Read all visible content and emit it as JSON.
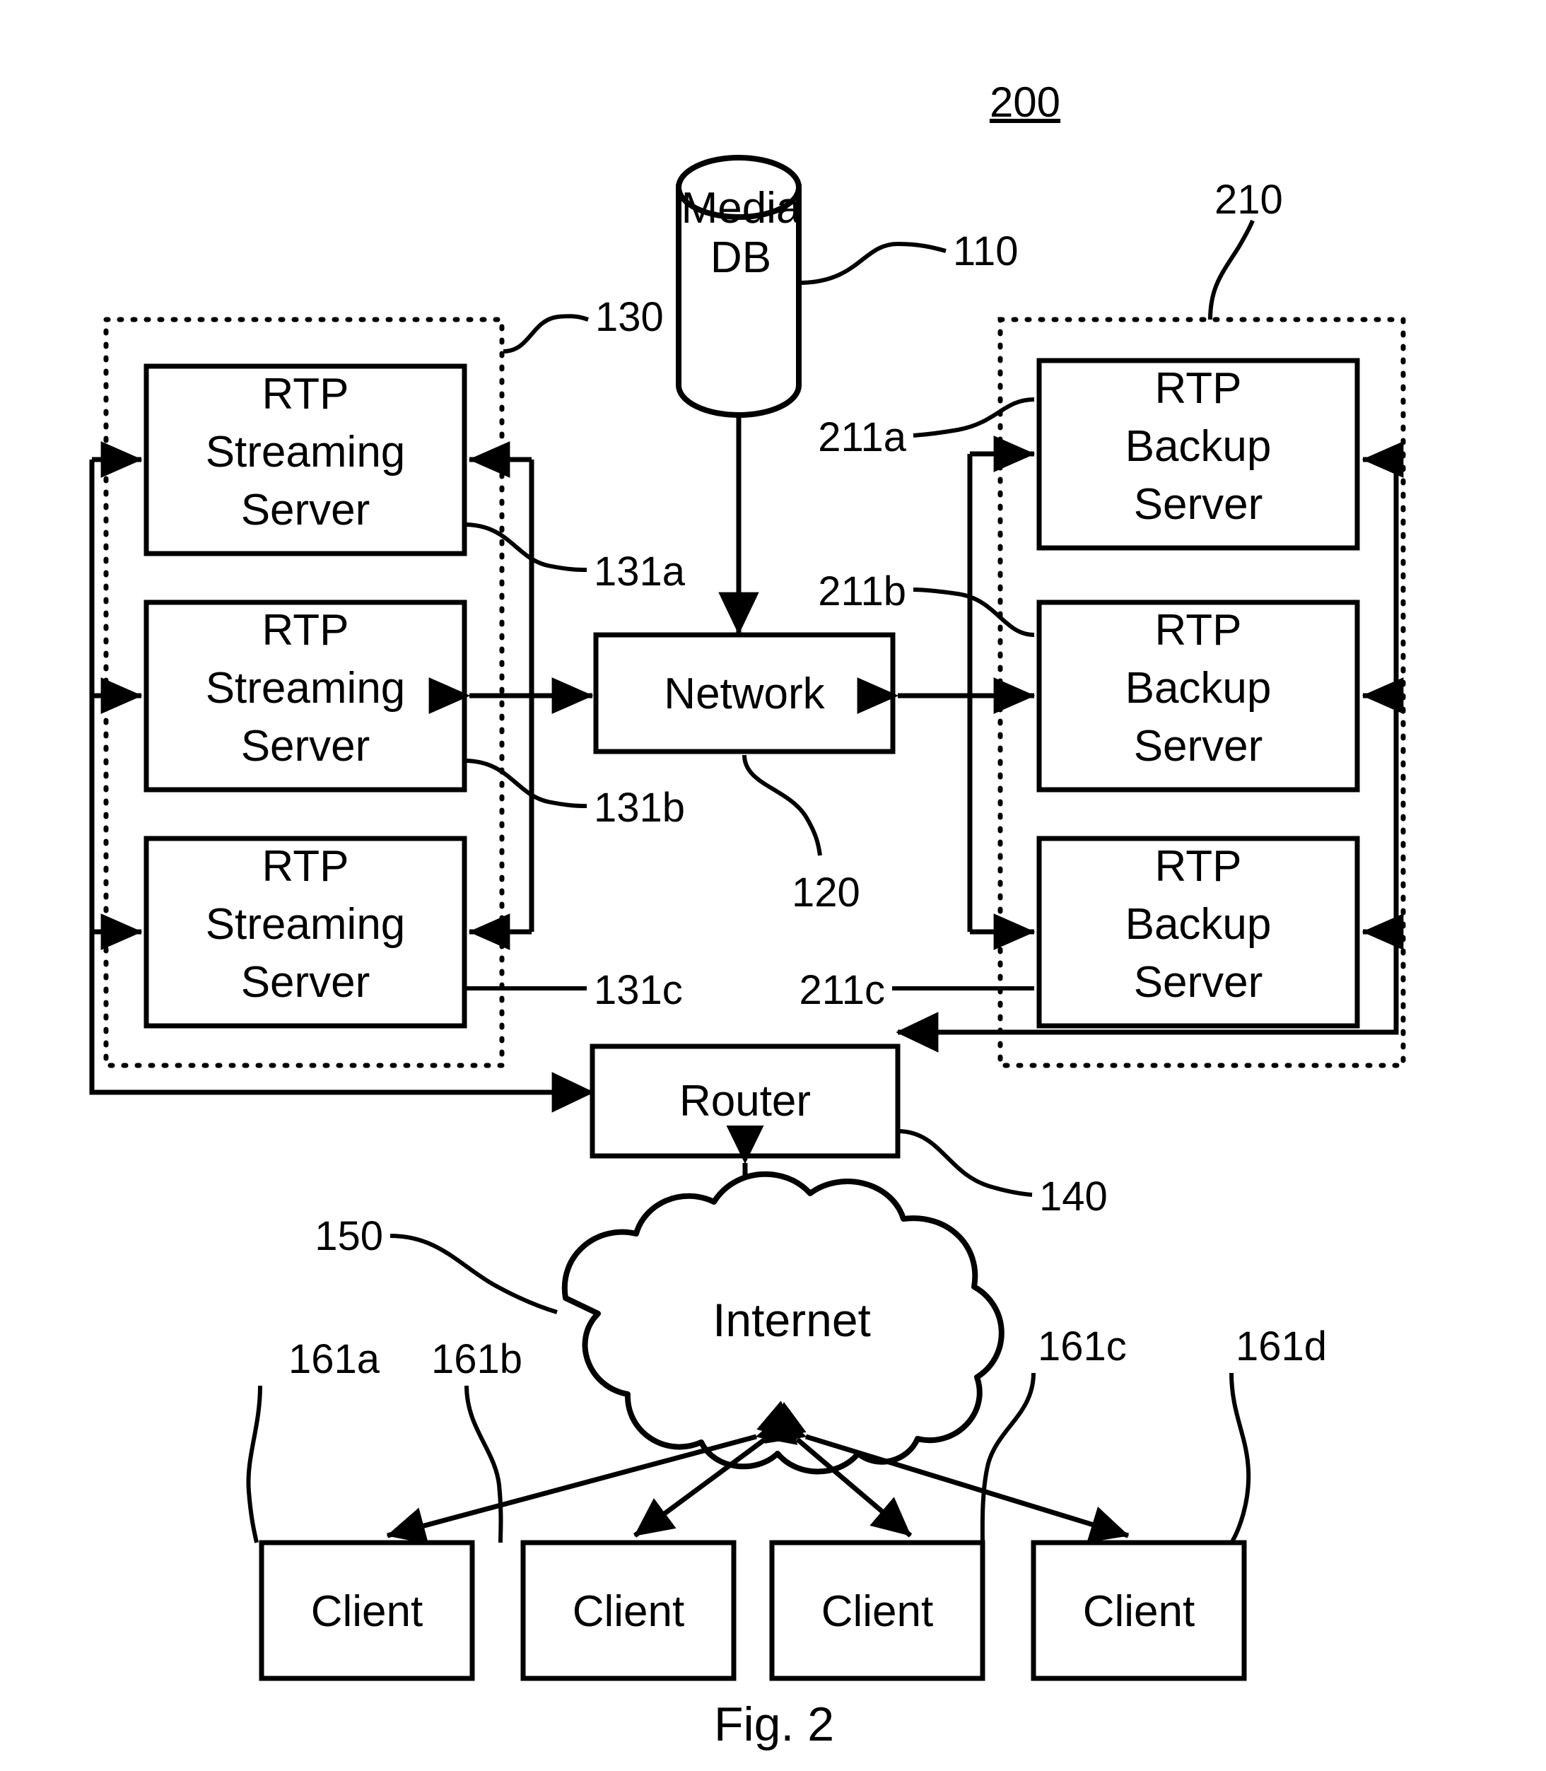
{
  "figure": {
    "caption": "Fig. 2",
    "system_ref": "200"
  },
  "nodes": {
    "media_db": {
      "line1": "Media",
      "line2": "DB",
      "ref": "110"
    },
    "network": {
      "label": "Network",
      "ref": "120"
    },
    "router": {
      "label": "Router",
      "ref": "140"
    },
    "internet": {
      "label": "Internet",
      "ref": "150"
    }
  },
  "groups": {
    "streaming_cluster": {
      "ref": "130"
    },
    "backup_cluster": {
      "ref": "210"
    }
  },
  "streaming_servers": [
    {
      "line1": "RTP",
      "line2": "Streaming",
      "line3": "Server",
      "ref": "131a"
    },
    {
      "line1": "RTP",
      "line2": "Streaming",
      "line3": "Server",
      "ref": "131b"
    },
    {
      "line1": "RTP",
      "line2": "Streaming",
      "line3": "Server",
      "ref": "131c"
    }
  ],
  "backup_servers": [
    {
      "line1": "RTP",
      "line2": "Backup",
      "line3": "Server",
      "ref": "211a"
    },
    {
      "line1": "RTP",
      "line2": "Backup",
      "line3": "Server",
      "ref": "211b"
    },
    {
      "line1": "RTP",
      "line2": "Backup",
      "line3": "Server",
      "ref": "211c"
    }
  ],
  "clients": [
    {
      "label": "Client",
      "ref": "161a"
    },
    {
      "label": "Client",
      "ref": "161b"
    },
    {
      "label": "Client",
      "ref": "161c"
    },
    {
      "label": "Client",
      "ref": "161d"
    }
  ],
  "colors": {
    "ink": "#000000",
    "paper": "#ffffff"
  }
}
